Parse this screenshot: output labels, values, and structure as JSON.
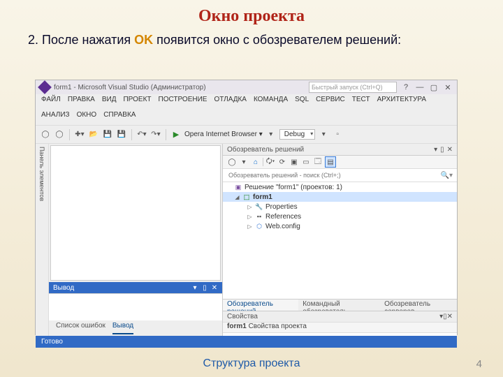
{
  "slide": {
    "title": "Окно проекта",
    "bullet": {
      "num": "2. ",
      "pre": "После нажатия ",
      "ok": "OK",
      "post": " появится окно с обозревателем решений:"
    },
    "footer": "Структура проекта",
    "page": "4"
  },
  "vs": {
    "title": "form1 - Microsoft Visual Studio (Администратор)",
    "quicklaunch": "Быстрый запуск (Ctrl+Q)",
    "menu": [
      "ФАЙЛ",
      "ПРАВКА",
      "ВИД",
      "ПРОЕКТ",
      "ПОСТРОЕНИЕ",
      "ОТЛАДКА",
      "КОМАНДА",
      "SQL",
      "СЕРВИС",
      "ТЕСТ",
      "АРХИТЕКТУРА",
      "АНАЛИЗ",
      "ОКНО",
      "СПРАВКА"
    ],
    "toolbar": {
      "start": "Opera Internet Browser ▾",
      "config": "Debug"
    },
    "toolbox": "Панель элементов",
    "output": {
      "title": "Вывод"
    },
    "bottomtabs": [
      "Список ошибок",
      "Вывод"
    ],
    "sln": {
      "title": "Обозреватель решений",
      "search": "Обозреватель решений - поиск (Ctrl+;)",
      "tree": [
        "Решение \"form1\" (проектов: 1)",
        "form1",
        "Properties",
        "References",
        "Web.config"
      ]
    },
    "righttabs": [
      "Обозреватель решений",
      "Командный обозреватель",
      "Обозреватель серверов"
    ],
    "props": {
      "title": "Свойства",
      "obj": "form1",
      "type": "Свойства проекта"
    },
    "status": "Готово"
  }
}
